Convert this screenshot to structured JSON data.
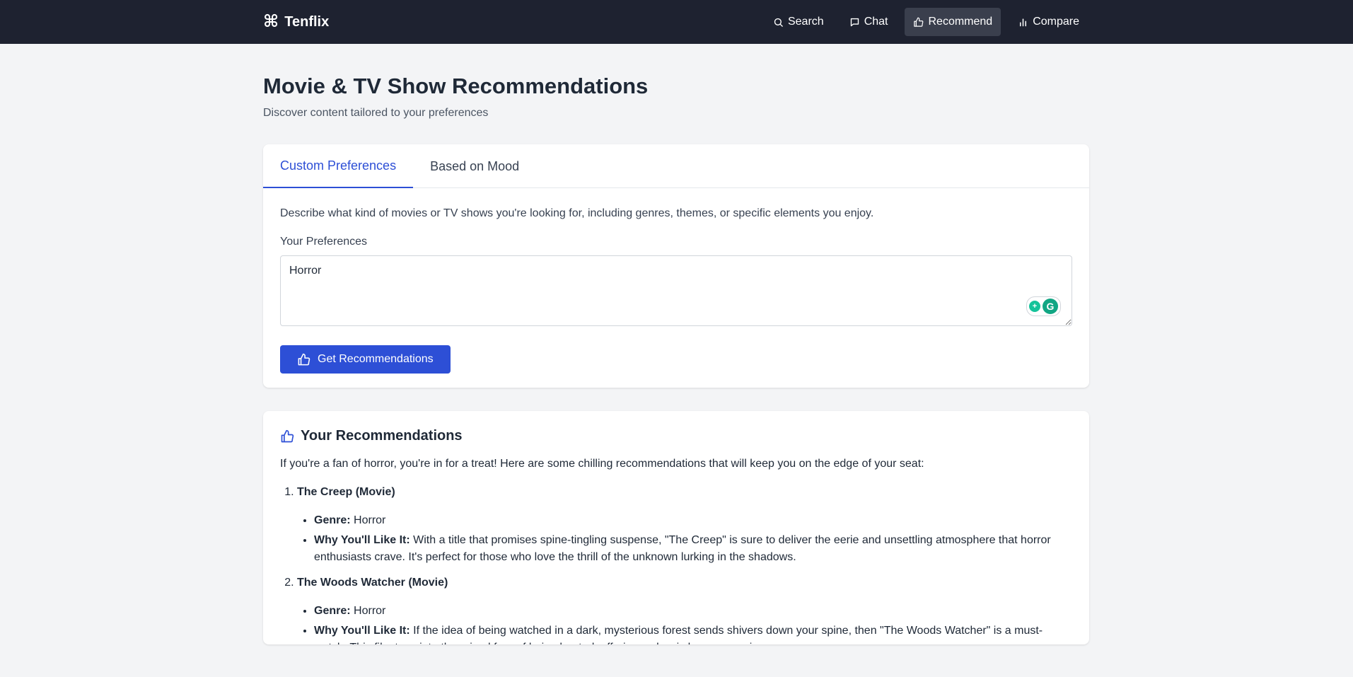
{
  "nav": {
    "brand": "Tenflix",
    "brand_icon": "command-icon",
    "links": [
      {
        "label": "Search",
        "icon": "search-icon"
      },
      {
        "label": "Chat",
        "icon": "chat-icon"
      },
      {
        "label": "Recommend",
        "icon": "thumbs-up-icon",
        "active": true
      },
      {
        "label": "Compare",
        "icon": "bar-chart-icon"
      }
    ]
  },
  "page": {
    "title": "Movie & TV Show Recommendations",
    "subtitle": "Discover content tailored to your preferences"
  },
  "tabs": [
    {
      "label": "Custom Preferences",
      "active": true
    },
    {
      "label": "Based on Mood",
      "active": false
    }
  ],
  "preferences": {
    "description": "Describe what kind of movies or TV shows you're looking for, including genres, themes, or specific elements you enjoy.",
    "label": "Your Preferences",
    "value": "Horror",
    "button_label": "Get Recommendations"
  },
  "results": {
    "title": "Your Recommendations",
    "intro": "If you're a fan of horror, you're in for a treat! Here are some chilling recommendations that will keep you on the edge of your seat:",
    "genre_label": "Genre:",
    "why_label": "Why You'll Like It:",
    "items": [
      {
        "title": "The Creep (Movie)",
        "genre": "Horror",
        "why": "With a title that promises spine-tingling suspense, \"The Creep\" is sure to deliver the eerie and unsettling atmosphere that horror enthusiasts crave. It's perfect for those who love the thrill of the unknown lurking in the shadows."
      },
      {
        "title": "The Woods Watcher (Movie)",
        "genre": "Horror",
        "why": "If the idea of being watched in a dark, mysterious forest sends shivers down your spine, then \"The Woods Watcher\" is a must-watch. This film taps into the primal fear of being hunted, offering a classic horror experience."
      }
    ]
  },
  "colors": {
    "nav_bg": "#1e2230",
    "accent": "#2d4fd6",
    "page_bg": "#f3f4f6"
  }
}
